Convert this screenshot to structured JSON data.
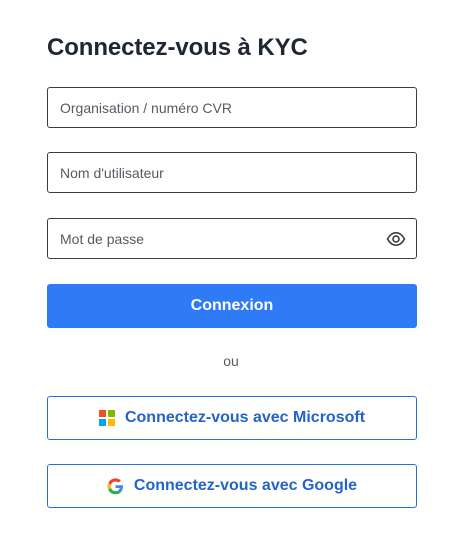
{
  "title": "Connectez-vous à KYC",
  "form": {
    "organisation_placeholder": "Organisation / numéro CVR",
    "username_placeholder": "Nom d'utilisateur",
    "password_placeholder": "Mot de passe",
    "password_toggle_icon": "eye-icon",
    "submit_label": "Connexion"
  },
  "separator": "ou",
  "sso": {
    "microsoft_label": "Connectez-vous avec Microsoft",
    "microsoft_icon": "microsoft-logo-icon",
    "google_label": "Connectez-vous avec Google",
    "google_icon": "google-logo-icon"
  },
  "colors": {
    "primary": "#2f7bf5",
    "sso_text": "#2463c9",
    "title": "#1f2733",
    "ms_red": "#f25022",
    "ms_green": "#7fba00",
    "ms_blue": "#00a4ef",
    "ms_yellow": "#ffb900"
  }
}
